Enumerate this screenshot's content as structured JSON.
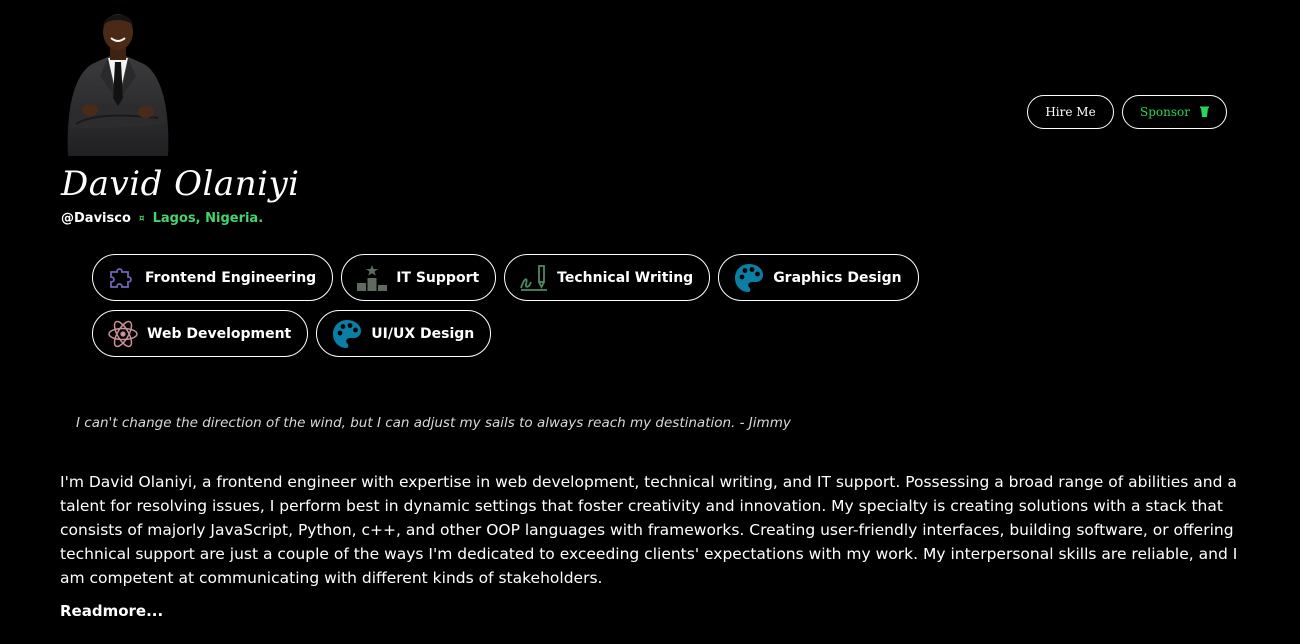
{
  "profile": {
    "name": "David Olaniyi",
    "handle": "@Davisco",
    "location": "Lagos, Nigeria."
  },
  "actions": {
    "hire_label": "Hire Me",
    "sponsor_label": "Sponsor"
  },
  "skills": [
    {
      "label": "Frontend Engineering",
      "icon": "puzzle-icon"
    },
    {
      "label": "IT Support",
      "icon": "podium-icon"
    },
    {
      "label": "Technical Writing",
      "icon": "writing-icon"
    },
    {
      "label": "Graphics Design",
      "icon": "palette-icon"
    },
    {
      "label": "Web Development",
      "icon": "react-atom-icon"
    },
    {
      "label": "UI/UX Design",
      "icon": "palette-icon"
    }
  ],
  "quote": "I can't change the direction of the wind, but I can adjust my sails to always reach my destination. - Jimmy",
  "bio": "I'm David Olaniyi, a frontend engineer with expertise in web development, technical writing, and IT support. Possessing a broad range of abilities and a talent for resolving issues, I perform best in dynamic settings that foster creativity and innovation. My specialty is creating solutions with a stack that consists of majorly JavaScript, Python, c++, and other OOP languages with frameworks. Creating user-friendly interfaces, building software, or offering technical support are just a couple of the ways I'm dedicated to exceeding clients' expectations with my work. My interpersonal skills are reliable, and I am competent at communicating with different kinds of stakeholders.",
  "readmore_label": "Readmore...",
  "colors": {
    "background": "#000000",
    "accent_green": "#46d36c",
    "palette_blue": "#0a7ea4"
  }
}
